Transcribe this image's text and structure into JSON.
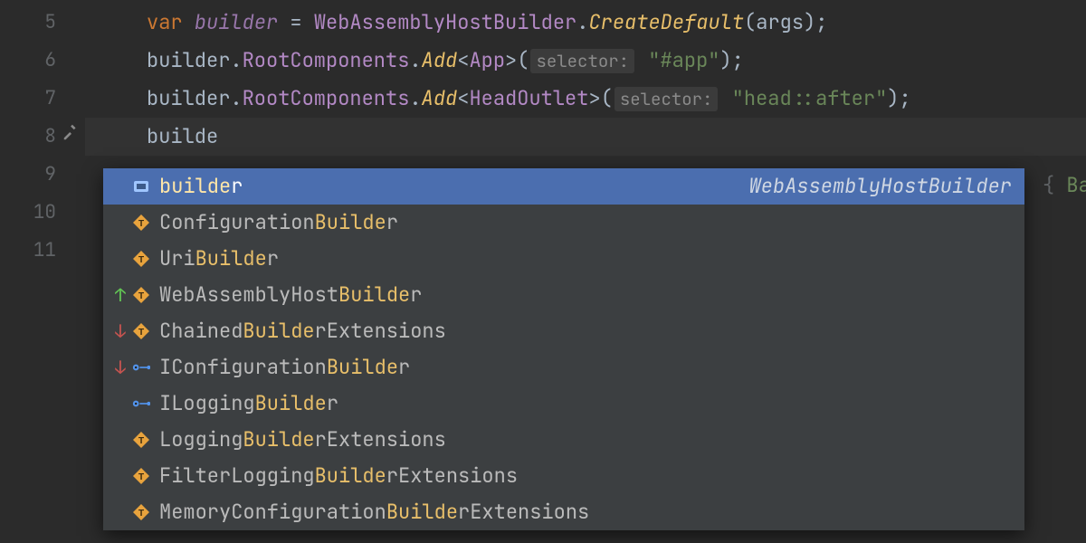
{
  "gutter": {
    "lines": [
      "5",
      "6",
      "7",
      "8",
      "9",
      "10",
      "11"
    ],
    "hammer_on": "8"
  },
  "code": {
    "l5": {
      "kw": "var",
      "name": "builder",
      "eq": " = ",
      "type": "WebAssemblyHostBuilder",
      "dot": ".",
      "method": "CreateDefault",
      "open": "(",
      "arg": "args",
      "close": ");"
    },
    "l6": {
      "name": "builder",
      "d1": ".",
      "prop": "RootComponents",
      "d2": ".",
      "method": "Add",
      "lt": "<",
      "gen": "App",
      "gt": ">(",
      "hint": "selector:",
      "sp": " ",
      "str": "\"#app\"",
      "close": ");"
    },
    "l7": {
      "name": "builder",
      "d1": ".",
      "prop": "RootComponents",
      "d2": ".",
      "method": "Add",
      "lt": "<",
      "gen": "HeadOutlet",
      "gt": ">(",
      "hint": "selector:",
      "sp": " ",
      "str": "\"head::after\"",
      "close": ");"
    },
    "l8": {
      "typed": "builde"
    },
    "behind": {
      "brace": "{ ",
      "id": "Bas"
    }
  },
  "popup": {
    "type_hint": "WebAssemblyHostBuilder",
    "items": [
      {
        "rank": "",
        "kind": "variable",
        "pre": "",
        "match": "builde",
        "post": "r",
        "selected": true
      },
      {
        "rank": "",
        "kind": "class",
        "pre": "Configuration",
        "match": "Builde",
        "post": "r",
        "selected": false
      },
      {
        "rank": "",
        "kind": "class",
        "pre": "Uri",
        "match": "Builde",
        "post": "r",
        "selected": false
      },
      {
        "rank": "up",
        "kind": "class",
        "pre": "WebAssemblyHost",
        "match": "Builde",
        "post": "r",
        "selected": false
      },
      {
        "rank": "down",
        "kind": "class",
        "pre": "Chained",
        "match": "Builde",
        "post": "rExtensions",
        "selected": false
      },
      {
        "rank": "down",
        "kind": "interface",
        "pre": "IConfiguration",
        "match": "Builde",
        "post": "r",
        "selected": false
      },
      {
        "rank": "",
        "kind": "interface",
        "pre": "ILogging",
        "match": "Builde",
        "post": "r",
        "selected": false
      },
      {
        "rank": "",
        "kind": "class",
        "pre": "Logging",
        "match": "Builde",
        "post": "rExtensions",
        "selected": false
      },
      {
        "rank": "",
        "kind": "class",
        "pre": "FilterLogging",
        "match": "Builde",
        "post": "rExtensions",
        "selected": false
      },
      {
        "rank": "",
        "kind": "class",
        "pre": "MemoryConfiguration",
        "match": "Builde",
        "post": "rExtensions",
        "selected": false
      }
    ]
  }
}
